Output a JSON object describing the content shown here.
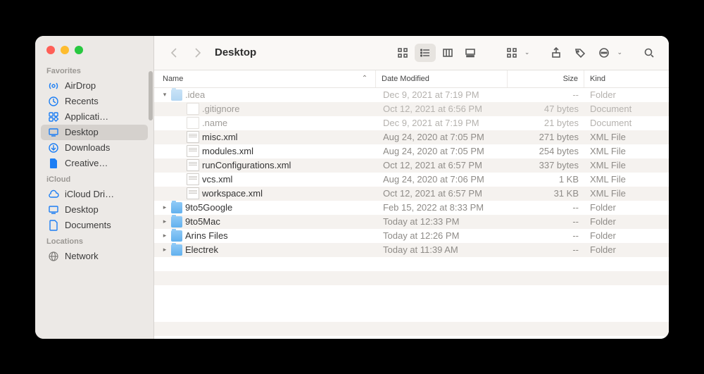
{
  "window_title": "Desktop",
  "sidebar": {
    "sections": [
      {
        "title": "Favorites",
        "items": [
          {
            "id": "airdrop",
            "label": "AirDrop",
            "icon": "airdrop"
          },
          {
            "id": "recents",
            "label": "Recents",
            "icon": "clock"
          },
          {
            "id": "applications",
            "label": "Applicati…",
            "icon": "apps"
          },
          {
            "id": "desktop",
            "label": "Desktop",
            "icon": "desktop",
            "selected": true
          },
          {
            "id": "downloads",
            "label": "Downloads",
            "icon": "download"
          },
          {
            "id": "creative",
            "label": "Creative…",
            "icon": "docfill"
          }
        ]
      },
      {
        "title": "iCloud",
        "items": [
          {
            "id": "icloud-drive",
            "label": "iCloud Dri…",
            "icon": "cloud"
          },
          {
            "id": "icloud-desktop",
            "label": "Desktop",
            "icon": "desktop"
          },
          {
            "id": "icloud-documents",
            "label": "Documents",
            "icon": "docoutline"
          }
        ]
      },
      {
        "title": "Locations",
        "items": [
          {
            "id": "network",
            "label": "Network",
            "icon": "globe",
            "gray": true
          }
        ]
      }
    ]
  },
  "columns": {
    "name": "Name",
    "date": "Date Modified",
    "size": "Size",
    "kind": "Kind"
  },
  "rows": [
    {
      "indent": 0,
      "disclosure": "down",
      "icon": "folder",
      "dim": true,
      "name": ".idea",
      "date": "Dec 9, 2021 at 7:19 PM",
      "size": "--",
      "kind": "Folder"
    },
    {
      "indent": 1,
      "disclosure": "",
      "icon": "doc",
      "dim": true,
      "name": ".gitignore",
      "date": "Oct 12, 2021 at 6:56 PM",
      "size": "47 bytes",
      "kind": "Document"
    },
    {
      "indent": 1,
      "disclosure": "",
      "icon": "doc",
      "dim": true,
      "name": ".name",
      "date": "Dec 9, 2021 at 7:19 PM",
      "size": "21 bytes",
      "kind": "Document"
    },
    {
      "indent": 1,
      "disclosure": "",
      "icon": "xml",
      "name": "misc.xml",
      "date": "Aug 24, 2020 at 7:05 PM",
      "size": "271 bytes",
      "kind": "XML File"
    },
    {
      "indent": 1,
      "disclosure": "",
      "icon": "xml",
      "name": "modules.xml",
      "date": "Aug 24, 2020 at 7:05 PM",
      "size": "254 bytes",
      "kind": "XML File"
    },
    {
      "indent": 1,
      "disclosure": "",
      "icon": "xml",
      "name": "runConfigurations.xml",
      "date": "Oct 12, 2021 at 6:57 PM",
      "size": "337 bytes",
      "kind": "XML File"
    },
    {
      "indent": 1,
      "disclosure": "",
      "icon": "xml",
      "name": "vcs.xml",
      "date": "Aug 24, 2020 at 7:06 PM",
      "size": "1 KB",
      "kind": "XML File"
    },
    {
      "indent": 1,
      "disclosure": "",
      "icon": "xml",
      "name": "workspace.xml",
      "date": "Oct 12, 2021 at 6:57 PM",
      "size": "31 KB",
      "kind": "XML File"
    },
    {
      "indent": 0,
      "disclosure": "right",
      "icon": "folder",
      "name": "9to5Google",
      "date": "Feb 15, 2022 at 8:33 PM",
      "size": "--",
      "kind": "Folder"
    },
    {
      "indent": 0,
      "disclosure": "right",
      "icon": "folder",
      "name": "9to5Mac",
      "date": "Today at 12:33 PM",
      "size": "--",
      "kind": "Folder"
    },
    {
      "indent": 0,
      "disclosure": "right",
      "icon": "folder",
      "name": "Arins Files",
      "date": "Today at 12:26 PM",
      "size": "--",
      "kind": "Folder"
    },
    {
      "indent": 0,
      "disclosure": "right",
      "icon": "folder",
      "name": "Electrek",
      "date": "Today at 11:39 AM",
      "size": "--",
      "kind": "Folder"
    }
  ]
}
